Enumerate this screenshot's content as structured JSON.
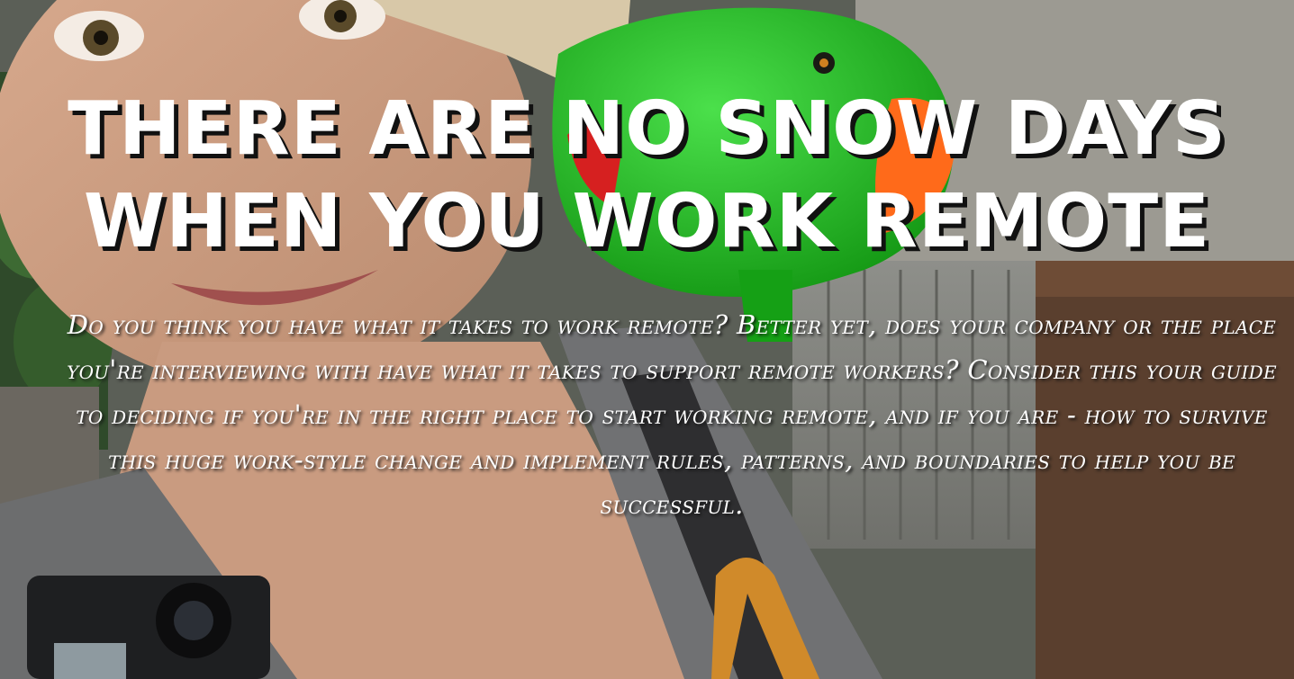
{
  "hero": {
    "headline_line1": "THERE ARE NO SNOW DAYS",
    "headline_line2": "WHEN YOU WORK REMOTE",
    "description": "Do you think you have what it takes to work remote? Better yet, does your company or the place you're interviewing with have what it takes to support remote workers? Consider this your guide to deciding if you're in the right place to start working remote, and if you are - how to survive this huge work-style change and implement rules, patterns, and boundaries to help you be successful.",
    "colors": {
      "text": "#ffffff",
      "text_shadow": "#111111",
      "parrot_green": "#1fb81f",
      "parrot_beak": "#ff6a1a",
      "backdrop": "#4a4f48"
    }
  }
}
